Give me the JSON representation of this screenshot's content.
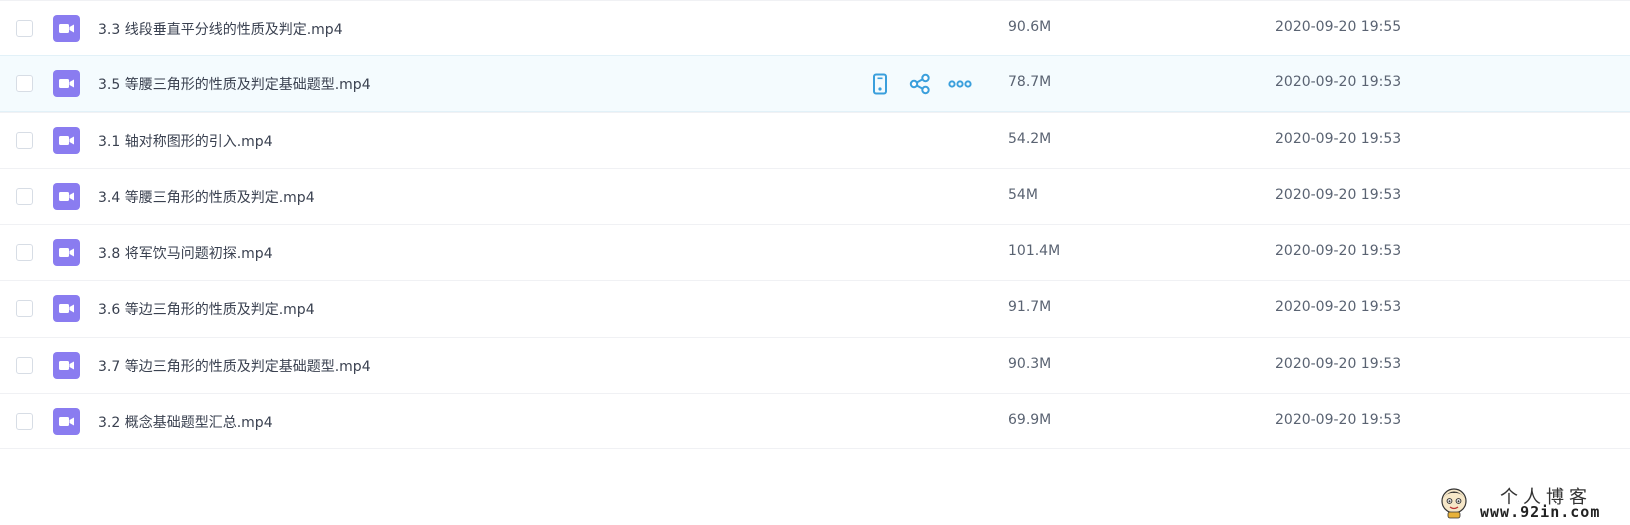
{
  "files": [
    {
      "name": "3.3 线段垂直平分线的性质及判定.mp4",
      "size": "90.6M",
      "date": "2020-09-20 19:55",
      "type_icon": "video-file-icon"
    },
    {
      "name": "3.5 等腰三角形的性质及判定基础题型.mp4",
      "size": "78.7M",
      "date": "2020-09-20 19:53",
      "type_icon": "video-file-icon",
      "hovered": true
    },
    {
      "name": "3.1 轴对称图形的引入.mp4",
      "size": "54.2M",
      "date": "2020-09-20 19:53",
      "type_icon": "video-file-icon"
    },
    {
      "name": "3.4 等腰三角形的性质及判定.mp4",
      "size": "54M",
      "date": "2020-09-20 19:53",
      "type_icon": "video-file-icon"
    },
    {
      "name": "3.8 将军饮马问题初探.mp4",
      "size": "101.4M",
      "date": "2020-09-20 19:53",
      "type_icon": "video-file-icon"
    },
    {
      "name": "3.6 等边三角形的性质及判定.mp4",
      "size": "91.7M",
      "date": "2020-09-20 19:53",
      "type_icon": "video-file-icon"
    },
    {
      "name": "3.7 等边三角形的性质及判定基础题型.mp4",
      "size": "90.3M",
      "date": "2020-09-20 19:53",
      "type_icon": "video-file-icon"
    },
    {
      "name": "3.2 概念基础题型汇总.mp4",
      "size": "69.9M",
      "date": "2020-09-20 19:53",
      "type_icon": "video-file-icon"
    }
  ],
  "row_actions": [
    {
      "icon": "phone-icon"
    },
    {
      "icon": "share-icon"
    },
    {
      "icon": "more-icon"
    }
  ],
  "watermark": {
    "title": "个人博客",
    "url": "www.92in.com"
  },
  "colors": {
    "accent": "#3a9fdc",
    "file_icon": "#8a7cf0",
    "hover_row": "#f4fbfe",
    "text_primary": "#3a4150",
    "text_secondary": "#5a6372"
  }
}
